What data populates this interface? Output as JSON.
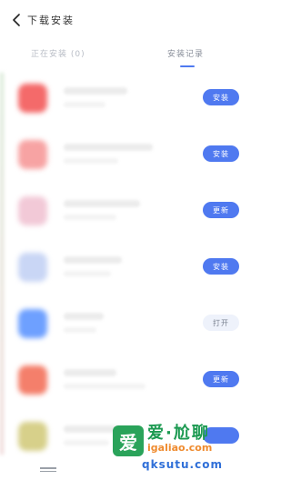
{
  "header": {
    "title": "下载安装"
  },
  "tabs": [
    {
      "label": "正在安装 (0)"
    },
    {
      "label": "安装记录"
    }
  ],
  "rows": [
    {
      "button": "安装",
      "icon_color": "#f46a6a"
    },
    {
      "button": "安装",
      "icon_color": "#f7a3a3"
    },
    {
      "button": "更新",
      "icon_color": "#f2c9d7"
    },
    {
      "button": "安装",
      "icon_color": "#c9d6f5"
    },
    {
      "button": "打开",
      "icon_color": "#6ea0ff"
    },
    {
      "button": "更新",
      "icon_color": "#f47f6b"
    },
    {
      "button": "",
      "icon_color": "#d7d08a"
    }
  ],
  "watermark": {
    "logo": "爱",
    "title": "爱·尬聊",
    "sub": "igaliao.com",
    "sub2": "qksutu.com"
  }
}
